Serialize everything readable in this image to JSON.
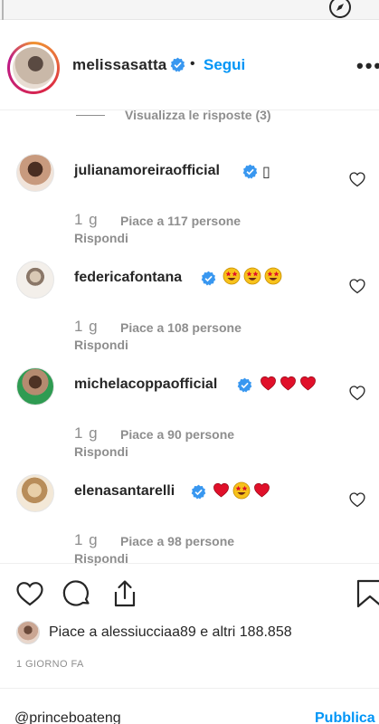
{
  "post": {
    "owner": "melissasatta",
    "separator": "•",
    "follow_label": "Segui",
    "more_label": "•••"
  },
  "thread": {
    "view_replies_label": "Visualizza le risposte (3)"
  },
  "replies": [
    {
      "username": "julianamoreiraofficial",
      "emoji_text": "▯",
      "time": "1 g",
      "likes": "Piace a 117 persone",
      "reply_label": "Rispondi"
    },
    {
      "username": "federicafontana",
      "emojis": [
        "star-struck",
        "star-struck",
        "star-struck"
      ],
      "time": "1 g",
      "likes": "Piace a 108 persone",
      "reply_label": "Rispondi"
    },
    {
      "username": "michelacoppaofficial",
      "emojis": [
        "red-heart",
        "red-heart",
        "red-heart"
      ],
      "time": "1 g",
      "likes": "Piace a 90 persone",
      "reply_label": "Rispondi"
    },
    {
      "username": "elenasantarelli",
      "emojis": [
        "red-heart",
        "star-struck",
        "red-heart"
      ],
      "time": "1 g",
      "likes": "Piace a 98 persone",
      "reply_label": "Rispondi"
    }
  ],
  "footer": {
    "likes_summary": "Piace a alessiucciaa89 e altri 188.858",
    "date": "1 GIORNO FA",
    "comment_value": "@princeboateng",
    "publish_label": "Pubblica"
  },
  "colors": {
    "accent": "#0095f6",
    "verified": "#3897f0",
    "heart_emoji": "#e0102a",
    "muted_text": "#8e8e8e"
  }
}
